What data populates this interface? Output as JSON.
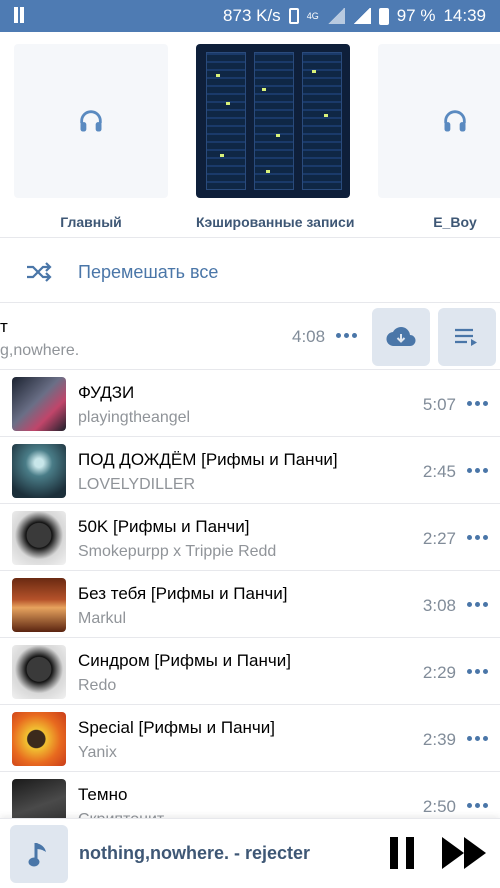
{
  "statusbar": {
    "speed": "873 K/s",
    "network": "4G",
    "battery": "97 %",
    "time": "14:39"
  },
  "playlists": [
    {
      "title": "Главный",
      "cover": "headphones-icon"
    },
    {
      "title": "Кэшированные записи",
      "cover": "server-photo"
    },
    {
      "title": "E_Boy",
      "cover": "headphones-icon"
    }
  ],
  "shuffle": {
    "label": "Перемешать все",
    "icon": "shuffle-icon"
  },
  "swiped_track": {
    "title": "т",
    "artist": "g,nowhere.",
    "duration": "4:08",
    "actions": [
      "cloud-download-icon",
      "add-to-queue-icon"
    ]
  },
  "tracks": [
    {
      "title": "ФУДЗИ",
      "artist": "playingtheangel",
      "duration": "5:07"
    },
    {
      "title": "ПОД ДОЖДЁМ [Рифмы и Панчи]",
      "artist": "LOVELYDILLER",
      "duration": "2:45"
    },
    {
      "title": "50K [Рифмы и Панчи]",
      "artist": "Smokepurpp x Trippie Redd",
      "duration": "2:27"
    },
    {
      "title": "Без тебя [Рифмы и Панчи]",
      "artist": "Markul",
      "duration": "3:08"
    },
    {
      "title": "Синдром [Рифмы и Панчи]",
      "artist": "Redo",
      "duration": "2:29"
    },
    {
      "title": "Special [Рифмы и Панчи]",
      "artist": "Yanix",
      "duration": "2:39"
    },
    {
      "title": "Темно",
      "artist": "Скриптонит",
      "duration": "2:50"
    }
  ],
  "player": {
    "now_playing": "nothing,nowhere. - rejecter"
  },
  "colors": {
    "accent": "#4a76a8",
    "statusbar": "#4e7bb3",
    "title": "#3e5775"
  }
}
